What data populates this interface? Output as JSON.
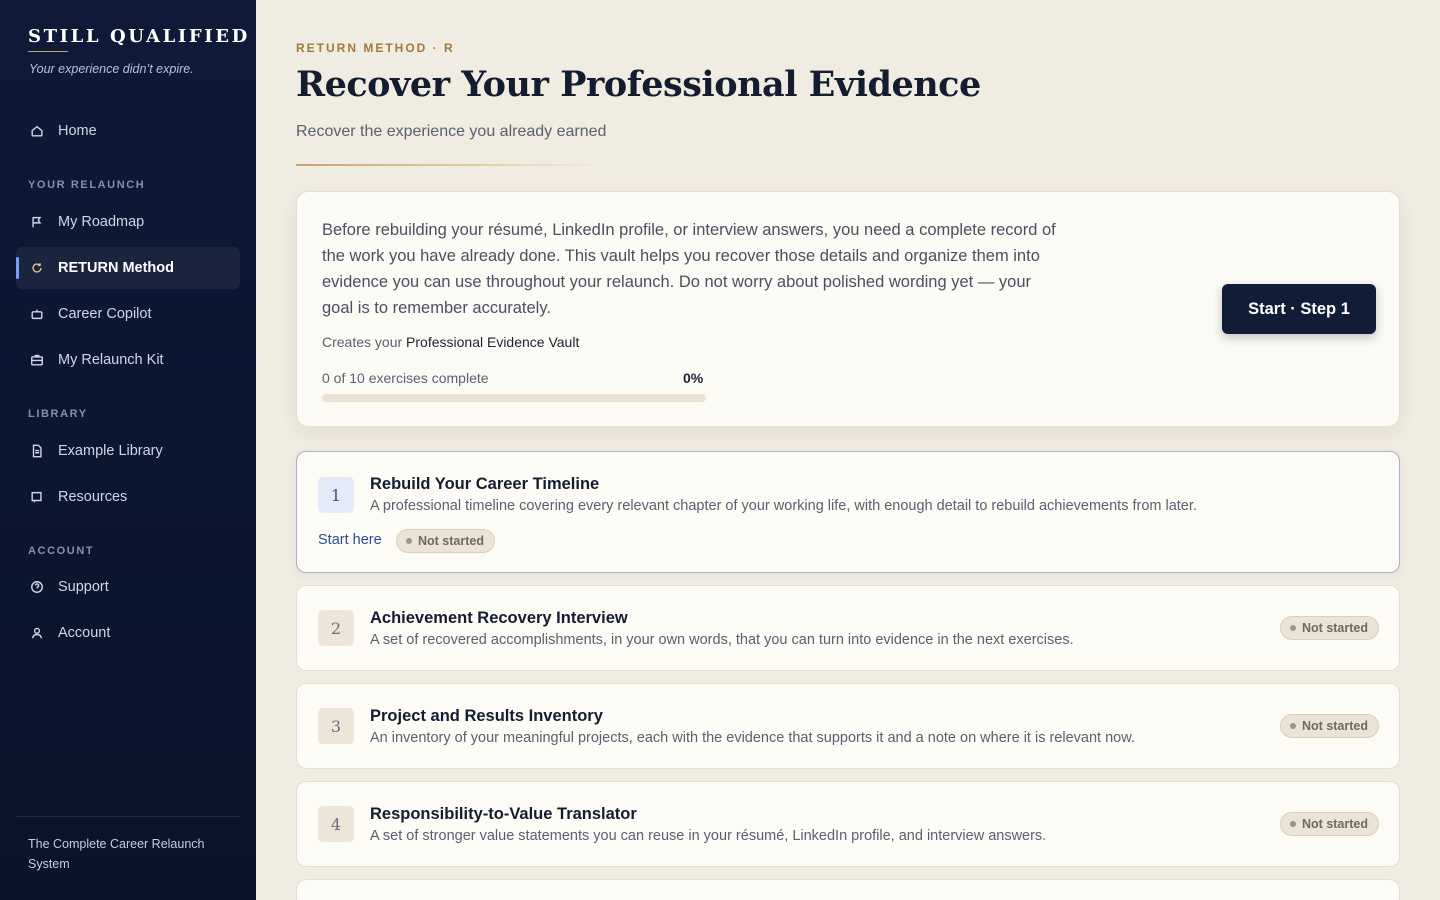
{
  "sidebar": {
    "brand": "STILL QUALIFIED",
    "tagline": "Your experience didn’t expire.",
    "home": {
      "label": "Home",
      "icon": "home-icon"
    },
    "sections": {
      "relaunch": "YOUR RELAUNCH",
      "library": "LIBRARY",
      "account": "ACCOUNT"
    },
    "relaunch_items": [
      {
        "label": "My Roadmap",
        "icon": "flag-icon"
      },
      {
        "label": "RETURN Method",
        "icon": "refresh-icon",
        "active": true
      },
      {
        "label": "Career Copilot",
        "icon": "robot-icon"
      },
      {
        "label": "My Relaunch Kit",
        "icon": "briefcase-icon"
      }
    ],
    "library_items": [
      {
        "label": "Example Library",
        "icon": "document-icon"
      },
      {
        "label": "Resources",
        "icon": "book-icon"
      }
    ],
    "account_items": [
      {
        "label": "Support",
        "icon": "help-circle-icon"
      },
      {
        "label": "Account",
        "icon": "user-icon"
      }
    ],
    "footer": "The Complete Career Relaunch System"
  },
  "header": {
    "eyebrow": "RETURN METHOD · R",
    "title": "Recover Your Professional Evidence",
    "subtitle": "Recover the experience you already earned"
  },
  "intro": {
    "text": "Before rebuilding your résumé, LinkedIn profile, or interview answers, you need a complete record of the work you have already done. This vault helps you recover those details and organize them into evidence you can use throughout your relaunch. Do not worry about polished wording yet — your goal is to remember accurately.",
    "creates_prefix": "Creates your",
    "creates_name": "Professional Evidence Vault",
    "progress_label": "0 of 10 exercises complete",
    "progress_percent": "0%",
    "progress_fraction": 0,
    "start_button": "Start · Step 1"
  },
  "exercises": [
    {
      "number": "1",
      "title": "Rebuild Your Career Timeline",
      "description": "A professional timeline covering every relevant chapter of your working life, with enough detail to rebuild achievements from later.",
      "status": "Not started",
      "start_link": "Start here"
    },
    {
      "number": "2",
      "title": "Achievement Recovery Interview",
      "description": "A set of recovered accomplishments, in your own words, that you can turn into evidence in the next exercises.",
      "status": "Not started"
    },
    {
      "number": "3",
      "title": "Project and Results Inventory",
      "description": "An inventory of your meaningful projects, each with the evidence that supports it and a note on where it is relevant now.",
      "status": "Not started"
    },
    {
      "number": "4",
      "title": "Responsibility-to-Value Translator",
      "description": "A set of stronger value statements you can reuse in your résumé, LinkedIn profile, and interview answers.",
      "status": "Not started"
    }
  ],
  "colors": {
    "sidebar_bg": "#0e1a38",
    "page_bg": "#f1ece2",
    "accent_gold": "#a2783d",
    "primary_button": "#111c36",
    "active_marker": "#7d9bff"
  }
}
